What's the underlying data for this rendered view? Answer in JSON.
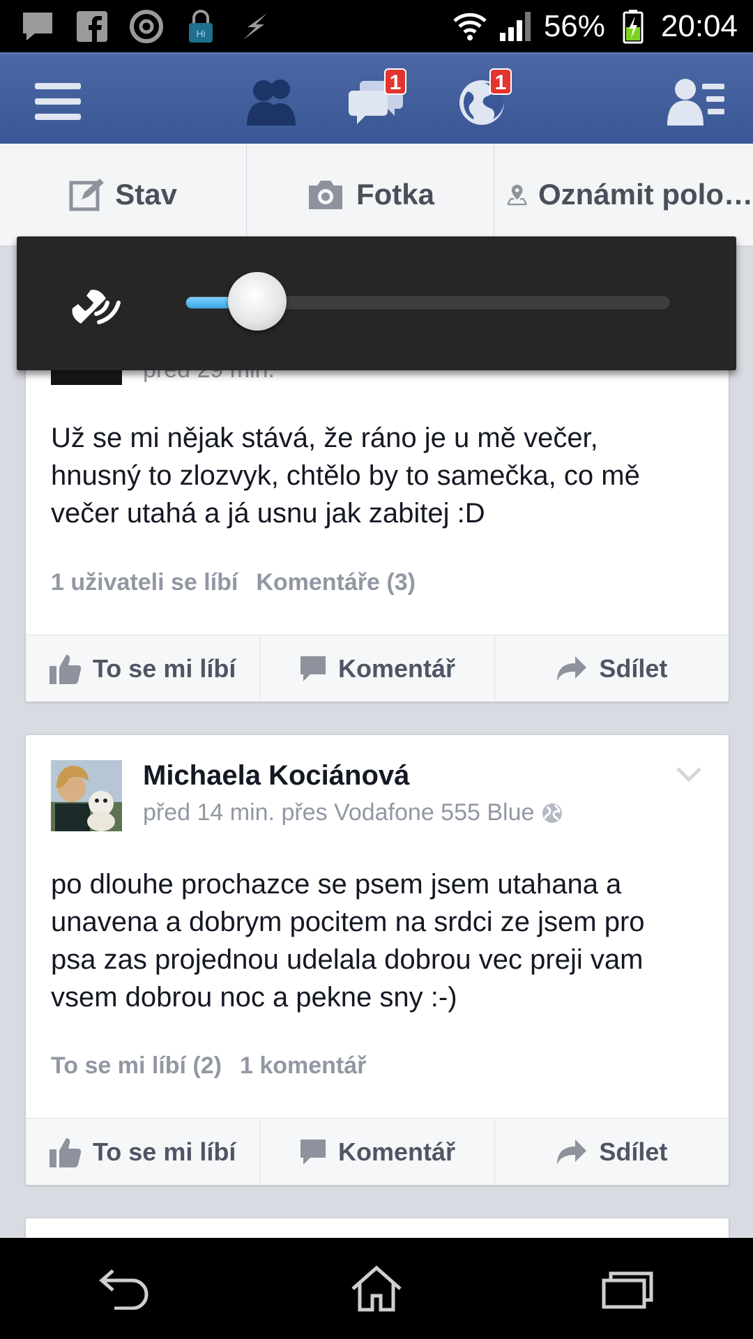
{
  "status_bar": {
    "battery": "56%",
    "time": "20:04",
    "left_icons": [
      "message-icon",
      "facebook-icon",
      "circle-app-icon",
      "lock-app-icon",
      "flash-icon"
    ],
    "right_icons": [
      "wifi-icon",
      "signal-icon",
      "battery-charging-icon"
    ]
  },
  "header": {
    "icons": [
      "menu-icon",
      "friend-requests-icon",
      "messages-icon",
      "notifications-icon",
      "account-icon"
    ],
    "messages_badge": "1",
    "notifications_badge": "1"
  },
  "composer": {
    "status_label": "Stav",
    "photo_label": "Fotka",
    "checkin_label": "Oznámit polo…"
  },
  "volume_overlay": {
    "icon": "phone-volume-icon",
    "level_fraction": 0.12,
    "accent": "#37a8e8"
  },
  "posts": [
    {
      "partial_meta": "před 29 min.",
      "text_lines": [
        "Už se mi nějak stává, že ráno je u mě večer,",
        "hnusný to zlozvyk, chtělo by to samečka, co mě",
        "večer utahá a já usnu jak zabitej :D"
      ],
      "likes": "1 uživateli se líbí",
      "comments": "Komentáře (3)"
    },
    {
      "author": "Michaela Kociánová",
      "meta": "před 14 min. přes Vodafone 555 Blue",
      "text_lines": [
        "po dlouhe prochazce se psem jsem utahana a",
        "unavena a dobrym pocitem na srdci ze jsem pro",
        "psa zas projednou udelala dobrou vec preji vam",
        "vsem dobrou noc a pekne sny :-)"
      ],
      "likes": "To se mi líbí (2)",
      "comments": "1 komentář"
    }
  ],
  "actions": {
    "like": "To se mi líbí",
    "comment": "Komentář",
    "share": "Sdílet"
  },
  "colors": {
    "header_blue": "#3b5998",
    "badge_red": "#e3342f",
    "meta_gray": "#9197a3"
  }
}
